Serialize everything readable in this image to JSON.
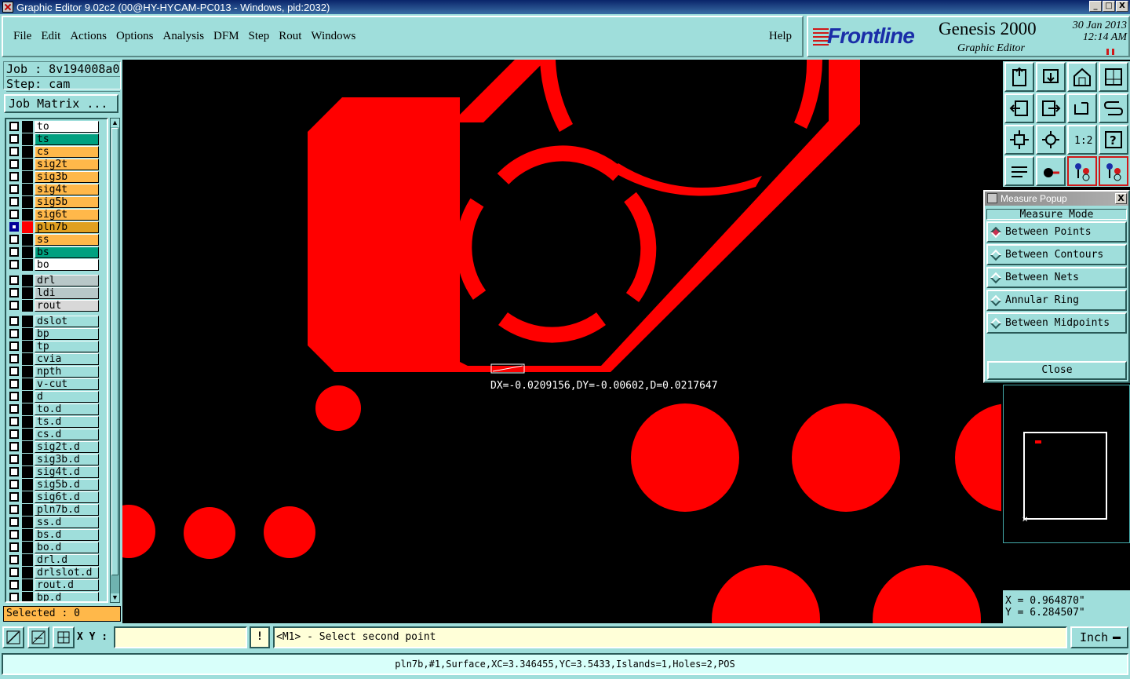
{
  "window": {
    "title": "Graphic Editor 9.02c2 (00@HY-HYCAM-PC013 - Windows, pid:2032)",
    "min": "_",
    "max": "□",
    "close": "X"
  },
  "menu": [
    "File",
    "Edit",
    "Actions",
    "Options",
    "Analysis",
    "DFM",
    "Step",
    "Rout",
    "Windows"
  ],
  "help": "Help",
  "brand": {
    "name": "Frontline",
    "product": "Genesis 2000",
    "module": "Graphic Editor",
    "date": "30 Jan 2013",
    "time": "12:14 AM"
  },
  "job": {
    "job": "Job : 8v194008a0",
    "step": "Step: cam",
    "matrix_button": "Job Matrix ..."
  },
  "layers": [
    {
      "name": "to",
      "color": "#ffffff",
      "icon": "◢"
    },
    {
      "name": "ts",
      "color": "#00a080",
      "icon": "◢"
    },
    {
      "name": "cs",
      "color": "#ffb84a",
      "icon": "◢"
    },
    {
      "name": "sig2t",
      "color": "#ffb84a",
      "icon": "◢"
    },
    {
      "name": "sig3b",
      "color": "#ffb84a",
      "icon": "◢"
    },
    {
      "name": "sig4t",
      "color": "#ffb84a",
      "icon": "◢"
    },
    {
      "name": "sig5b",
      "color": "#ffb84a",
      "icon": "◢"
    },
    {
      "name": "sig6t",
      "color": "#ffb84a",
      "icon": "◢"
    },
    {
      "name": "pln7b",
      "color": "#e0a020",
      "icon": "◢⊞",
      "selected": true
    },
    {
      "name": "ss",
      "color": "#ffb84a",
      "icon": "◢"
    },
    {
      "name": "bs",
      "color": "#00a080",
      "icon": "◢"
    },
    {
      "name": "bo",
      "color": "#ffffff",
      "icon": "◢"
    },
    {
      "name": "drl",
      "color": "#b8c8c8",
      "icon": ""
    },
    {
      "name": "ldi",
      "color": "#b8c8c8",
      "icon": ""
    },
    {
      "name": "rout",
      "color": "#d8d8d8",
      "icon": ""
    },
    {
      "name": "dslot",
      "color": "#9fdedb",
      "icon": ""
    },
    {
      "name": "bp",
      "color": "#9fdedb",
      "icon": "◢"
    },
    {
      "name": "tp",
      "color": "#9fdedb",
      "icon": "◢"
    },
    {
      "name": "cvia",
      "color": "#9fdedb",
      "icon": ""
    },
    {
      "name": "npth",
      "color": "#9fdedb",
      "icon": ""
    },
    {
      "name": "v-cut",
      "color": "#9fdedb",
      "icon": ""
    },
    {
      "name": "d",
      "color": "#9fdedb",
      "icon": ""
    },
    {
      "name": "to.d",
      "color": "#9fdedb",
      "icon": "◢"
    },
    {
      "name": "ts.d",
      "color": "#9fdedb",
      "icon": "◢"
    },
    {
      "name": "cs.d",
      "color": "#9fdedb",
      "icon": "◢"
    },
    {
      "name": "sig2t.d",
      "color": "#9fdedb",
      "icon": "◢"
    },
    {
      "name": "sig3b.d",
      "color": "#9fdedb",
      "icon": "◢"
    },
    {
      "name": "sig4t.d",
      "color": "#9fdedb",
      "icon": "◢"
    },
    {
      "name": "sig5b.d",
      "color": "#9fdedb",
      "icon": "◢"
    },
    {
      "name": "sig6t.d",
      "color": "#9fdedb",
      "icon": "◢"
    },
    {
      "name": "pln7b.d",
      "color": "#9fdedb",
      "icon": "◢"
    },
    {
      "name": "ss.d",
      "color": "#9fdedb",
      "icon": "◢"
    },
    {
      "name": "bs.d",
      "color": "#9fdedb",
      "icon": "◢"
    },
    {
      "name": "bo.d",
      "color": "#9fdedb",
      "icon": "◢"
    },
    {
      "name": "drl.d",
      "color": "#9fdedb",
      "icon": ""
    },
    {
      "name": "drlslot.d",
      "color": "#9fdedb",
      "icon": ""
    },
    {
      "name": "rout.d",
      "color": "#9fdedb",
      "icon": ""
    },
    {
      "name": "bp.d",
      "color": "#9fdedb",
      "icon": "◢"
    }
  ],
  "selected_label": "Selected : 0",
  "measure_text": "DX=-0.0209156,DY=-0.00602,D=0.0217647",
  "popup": {
    "title": "Measure Popup",
    "header": "Measure Mode",
    "options": [
      "Between Points",
      "Between Contours",
      "Between Nets",
      "Annular Ring",
      "Between Midpoints"
    ],
    "active": 0,
    "close": "Close"
  },
  "coords": {
    "x": "X  =  0.964870\"",
    "y": "Y  =  6.284507\""
  },
  "xy_label": "X Y :",
  "bang": "!",
  "prompt": "<M1> - Select second point",
  "units": "Inch",
  "status": "pln7b,#1,Surface,XC=3.346455,YC=3.5433,Islands=1,Holes=2,POS",
  "colors": {
    "feature": "#ff0000",
    "bg": "#9fdedb",
    "canvas": "#000000"
  },
  "tool_icons": [
    "zoom-home-icon",
    "zoom-in-icon",
    "home-view-icon",
    "window-icon",
    "pan-left-icon",
    "pan-right-icon",
    "redraw-icon",
    "snap-icon",
    "fit-icon",
    "center-icon",
    "scale-icon",
    "help-icon",
    "tools-icon",
    "probe-icon",
    "net-highlight-icon",
    "net-select-icon"
  ]
}
